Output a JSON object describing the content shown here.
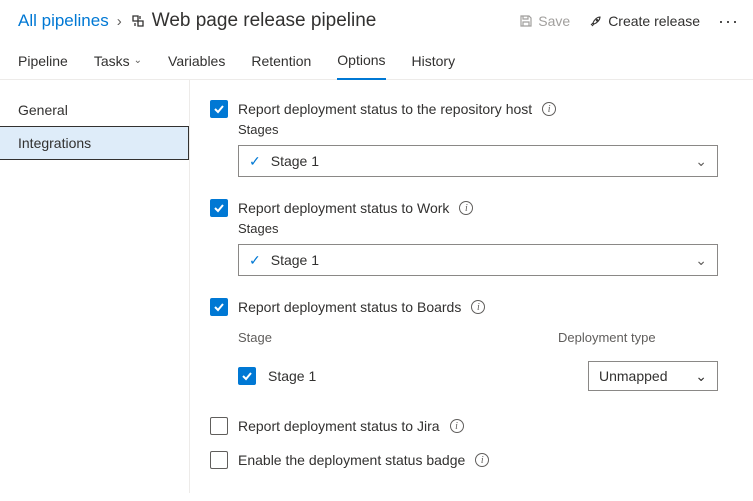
{
  "breadcrumb": {
    "root": "All pipelines"
  },
  "page": {
    "title": "Web page release pipeline"
  },
  "actions": {
    "save": "Save",
    "create": "Create release"
  },
  "tabs": {
    "pipeline": "Pipeline",
    "tasks": "Tasks",
    "variables": "Variables",
    "retention": "Retention",
    "options": "Options",
    "history": "History"
  },
  "sidenav": {
    "general": "General",
    "integrations": "Integrations"
  },
  "opts": {
    "repo": {
      "label": "Report deployment status to the repository host",
      "stages_label": "Stages",
      "value": "Stage 1"
    },
    "work": {
      "label": "Report deployment status to Work",
      "stages_label": "Stages",
      "value": "Stage 1"
    },
    "boards": {
      "label": "Report deployment status to Boards",
      "col_stage": "Stage",
      "col_deploy": "Deployment type",
      "row_stage": "Stage 1",
      "row_deploy": "Unmapped"
    },
    "jira": {
      "label": "Report deployment status to Jira"
    },
    "badge": {
      "label": "Enable the deployment status badge"
    }
  }
}
